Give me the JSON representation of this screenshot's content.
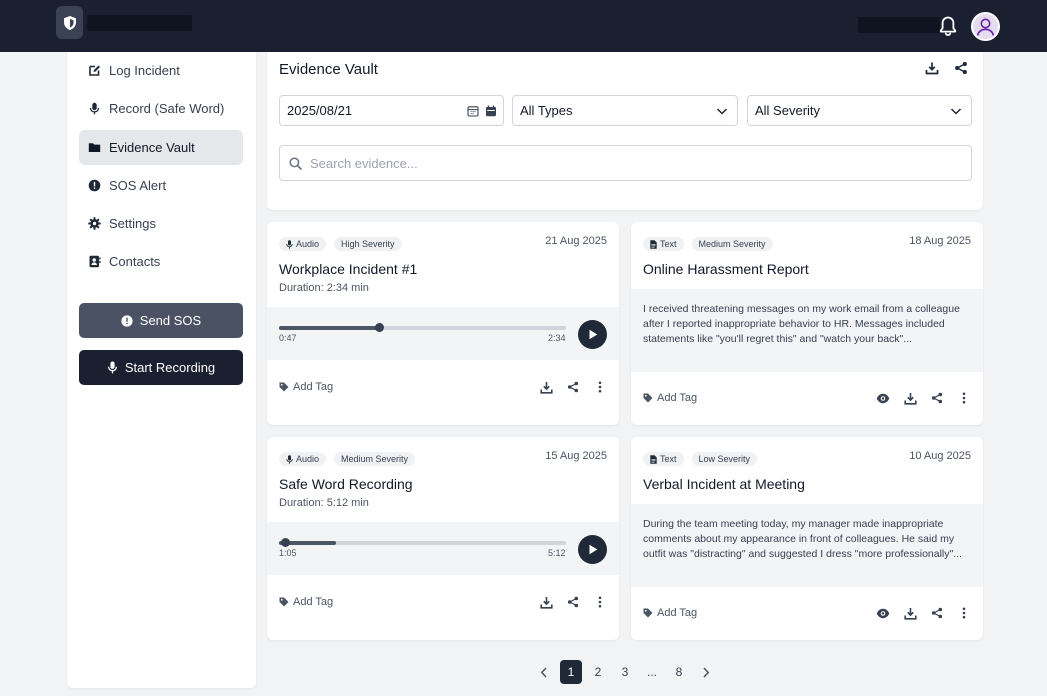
{
  "header": {
    "logo_icon": "shield-icon",
    "notifications_icon": "bell-icon",
    "avatar_icon": "user-avatar-icon",
    "colors": {
      "bar": "#1a2030",
      "avatar_bg": "#e6dcef"
    }
  },
  "sidebar": {
    "items": [
      {
        "label": "Log Incident",
        "icon": "edit-icon"
      },
      {
        "label": "Record (Safe Word)",
        "icon": "microphone-icon"
      },
      {
        "label": "Evidence Vault",
        "icon": "folder-icon",
        "active": true
      },
      {
        "label": "SOS Alert",
        "icon": "alert-circle-icon"
      },
      {
        "label": "Settings",
        "icon": "gear-icon"
      },
      {
        "label": "Contacts",
        "icon": "address-book-icon"
      }
    ],
    "send_sos_label": "Send SOS",
    "start_recording_label": "Start Recording"
  },
  "vault": {
    "title": "Evidence Vault",
    "date_value": "2025/08/21",
    "type_filter": "All Types",
    "severity_filter": "All Severity",
    "search_placeholder": "Search evidence..."
  },
  "cards": [
    {
      "type": "Audio",
      "severity": "High Severity",
      "date": "21 Aug 2025",
      "title": "Workplace Incident #1",
      "duration": "Duration: 2:34 min",
      "current_time": "0:47",
      "total_time": "2:34",
      "progress": 0.35,
      "tag_label": "Add Tag"
    },
    {
      "type": "Text",
      "severity": "Medium Severity",
      "date": "18 Aug 2025",
      "title": "Online Harassment Report",
      "excerpt": "I received threatening messages on my work email from a colleague after I reported inappropriate behavior to HR. Messages included statements like \"you'll regret this\" and \"watch your back\"...",
      "tag_label": "Add Tag"
    },
    {
      "type": "Audio",
      "severity": "Medium Severity",
      "date": "15 Aug 2025",
      "title": "Safe Word Recording",
      "duration": "Duration: 5:12 min",
      "current_time": "1:05",
      "total_time": "5:12",
      "progress": 0.2,
      "tag_label": "Add Tag"
    },
    {
      "type": "Text",
      "severity": "Low Severity",
      "date": "10 Aug 2025",
      "title": "Verbal Incident at Meeting",
      "excerpt": "During the team meeting today, my manager made inappropriate comments about my appearance in front of colleagues. He said my outfit was \"distracting\" and suggested I dress \"more professionally\"...",
      "tag_label": "Add Tag"
    }
  ],
  "pagination": {
    "prev_icon": "chevron-left-icon",
    "next_icon": "chevron-right-icon",
    "pages": [
      "1",
      "2",
      "3",
      "...",
      "8"
    ],
    "current": "1"
  }
}
